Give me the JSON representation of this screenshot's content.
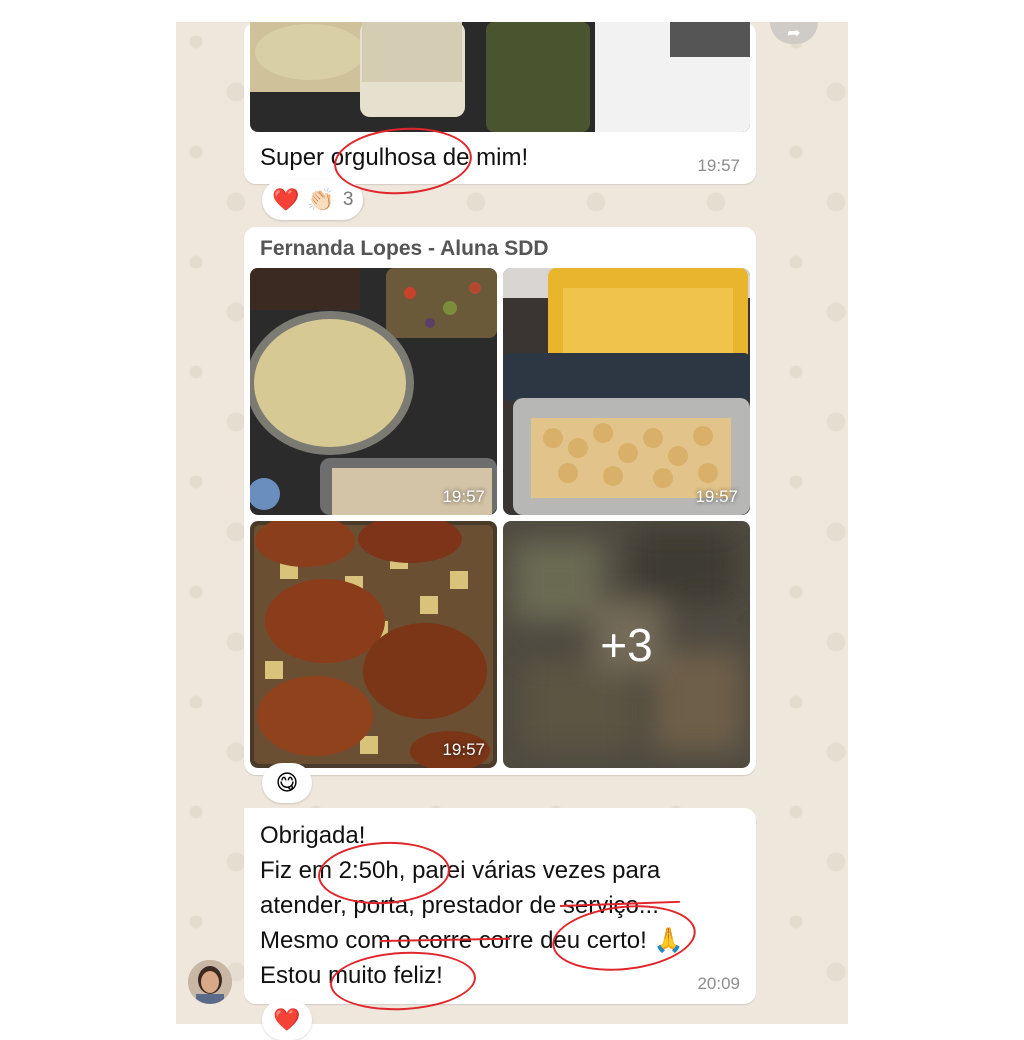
{
  "messages": [
    {
      "caption": "Super orgulhosa de mim!",
      "time": "19:57",
      "reactions": {
        "heart": "❤️",
        "clap": "👏🏻",
        "count": "3"
      }
    },
    {
      "sender": "Fernanda Lopes - Aluna SDD",
      "photos": [
        {
          "alt": "Shredded chicken and vegetables in glass containers",
          "time": "19:57"
        },
        {
          "alt": "Chickpeas and pumpkin puree in glass containers",
          "time": "19:57"
        },
        {
          "alt": "Roasted chicken thighs with potatoes on a baking tray",
          "time": "19:57"
        },
        {
          "alt": "Blurred preview of more photos",
          "more": "+3"
        }
      ],
      "reaction": "😋"
    },
    {
      "lines": [
        "Obrigada!",
        "Fiz em 2:50h, parei várias vezes para",
        "atender, porta, prestador de serviço...",
        "Mesmo com o corre corre deu certo! 🙏",
        "Estou muito feliz!"
      ],
      "time": "20:09",
      "reaction": "❤️"
    }
  ],
  "colors": {
    "chat_bg": "#efe7dc",
    "bubble": "#ffffff",
    "annotation": "#e0262b"
  }
}
